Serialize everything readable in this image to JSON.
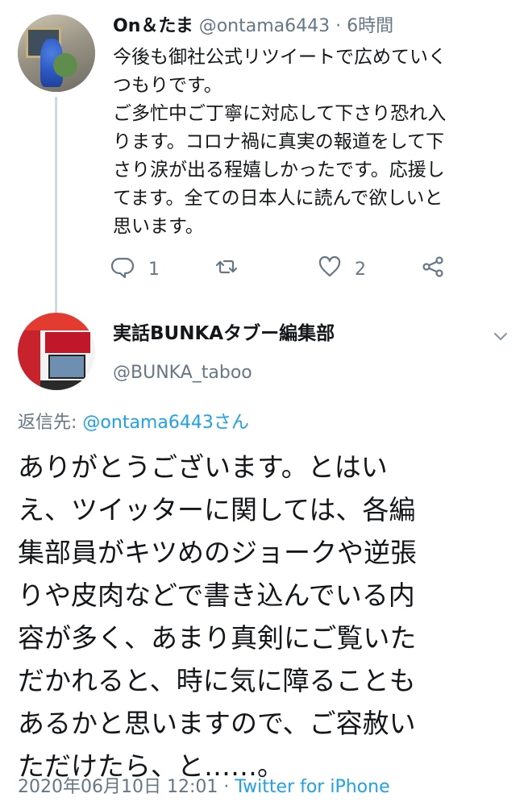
{
  "tweet1": {
    "display_name": "On＆たま",
    "handle": "@ontama6443",
    "separator": "·",
    "time": "6時間",
    "text_lines": [
      "今後も御社公式リツイートで広めていく",
      "つもりです。",
      "ご多忙中ご丁寧に対応して下さり恐れ入",
      "ります。コロナ禍に真実の報道をして下",
      "さり涙が出る程嬉しかったです。応援し",
      "てます。全ての日本人に読んで欲しいと",
      "思います。"
    ],
    "actions": {
      "reply_count": "1",
      "retweet_count": "",
      "like_count": "2"
    }
  },
  "tweet2": {
    "display_name": "実話BUNKAタブー編集部",
    "handle": "@BUNKA_taboo",
    "reply_prefix": "返信先:",
    "reply_to": "@ontama6443さん",
    "text_lines": [
      "ありがとうございます。とはい",
      "え、ツイッターに関しては、各編",
      "集部員がキツめのジョークや逆張",
      "りや皮肉などで書き込んでいる内",
      "容が多く、あまり真剣にご覧いた",
      "だかれると、時に気に障ることも",
      "あるかと思いますので、ご容赦い",
      "ただけたら、と……。"
    ],
    "timestamp": "2020年06月10日 12:01",
    "footer_separator": "·",
    "source": "Twitter for iPhone"
  },
  "icons": {
    "reply": "reply-icon",
    "retweet": "retweet-icon",
    "like": "heart-icon",
    "share": "share-icon",
    "menu": "chevron-down-icon"
  },
  "colors": {
    "text": "#14171a",
    "secondary": "#657786",
    "link": "#1da1f2",
    "thread_line": "#cfd9de"
  }
}
